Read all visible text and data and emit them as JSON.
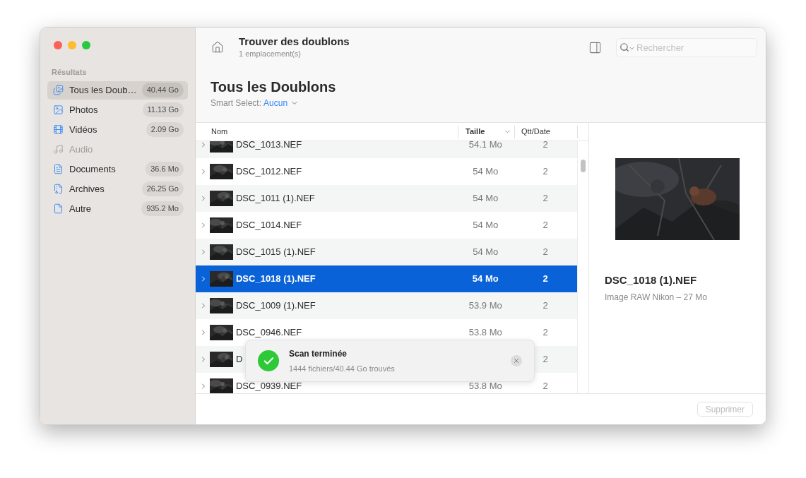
{
  "sidebar": {
    "section": "Résultats",
    "items": [
      {
        "label": "Tous les Doub…",
        "badge": "40.44 Go",
        "selected": true,
        "disabled": false,
        "kind": "all"
      },
      {
        "label": "Photos",
        "badge": "11.13 Go",
        "selected": false,
        "disabled": false
      },
      {
        "label": "Vidéos",
        "badge": "2.09 Go",
        "selected": false,
        "disabled": false,
        "kind": "video"
      },
      {
        "label": "Audio",
        "selected": false,
        "disabled": true,
        "kind": "audio"
      },
      {
        "label": "Documents",
        "badge": "36.6 Mo",
        "selected": false,
        "disabled": false,
        "kind": "document"
      },
      {
        "label": "Archives",
        "badge": "26.25 Go",
        "selected": false,
        "disabled": false,
        "kind": "archive"
      },
      {
        "label": "Autre",
        "badge": "935.2 Mo",
        "selected": false,
        "disabled": false,
        "kind": "other"
      }
    ]
  },
  "toolbar": {
    "title": "Trouver des doublons",
    "subtitle": "1 emplacement(s)",
    "search": {
      "placeholder": "Rechercher"
    }
  },
  "heading": "Tous les Doublons",
  "smart_select": {
    "label": "Smart Select:",
    "value": "Aucun"
  },
  "table": {
    "columns": [
      {
        "label": "Nom",
        "sorted": false
      },
      {
        "label": "Taille",
        "sorted": true
      },
      {
        "label": "Qtt/Date",
        "sorted": false
      }
    ],
    "rows": [
      {
        "name": "DSC_1013.NEF",
        "size": "54.1 Mo",
        "count": "2",
        "selected": false
      },
      {
        "name": "DSC_1012.NEF",
        "size": "54 Mo",
        "count": "2",
        "selected": false
      },
      {
        "name": "DSC_1011 (1).NEF",
        "size": "54 Mo",
        "count": "2",
        "selected": false
      },
      {
        "name": "DSC_1014.NEF",
        "size": "54 Mo",
        "count": "2",
        "selected": false
      },
      {
        "name": "DSC_1015 (1).NEF",
        "size": "54 Mo",
        "count": "2",
        "selected": false
      },
      {
        "name": "DSC_1018 (1).NEF",
        "size": "54 Mo",
        "count": "2",
        "selected": true
      },
      {
        "name": "DSC_1009 (1).NEF",
        "size": "53.9 Mo",
        "count": "2",
        "selected": false
      },
      {
        "name": "DSC_0946.NEF",
        "size": "53.8 Mo",
        "count": "2",
        "selected": false
      },
      {
        "name": "D",
        "count": "2",
        "selected": false
      },
      {
        "name": "DSC_0939.NEF",
        "size": "53.8 Mo",
        "count": "2",
        "selected": false
      }
    ]
  },
  "preview": {
    "name": "DSC_1018 (1).NEF",
    "info": "Image RAW Nikon – 27 Mo"
  },
  "toast": {
    "title": "Scan terminée",
    "message": "1444 fichiers/40.44 Go trouvés"
  },
  "footer": {
    "button": {
      "label": "Supprimer",
      "disabled": true
    }
  }
}
